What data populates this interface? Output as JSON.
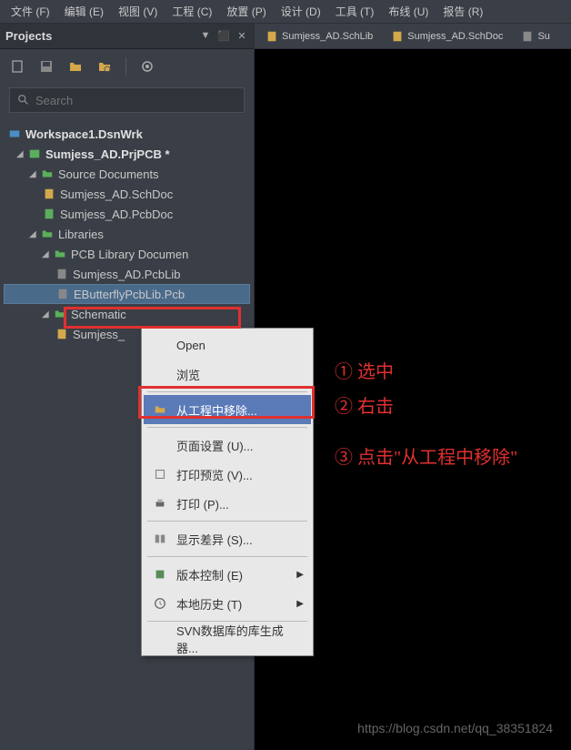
{
  "menubar": {
    "items": [
      "文件 (F)",
      "编辑 (E)",
      "视图 (V)",
      "工程 (C)",
      "放置 (P)",
      "设计 (D)",
      "工具 (T)",
      "布线 (U)",
      "报告 (R)"
    ]
  },
  "panel": {
    "title": "Projects"
  },
  "tabs": [
    "Sumjess_AD.SchLib",
    "Sumjess_AD.SchDoc",
    "Su"
  ],
  "search": {
    "placeholder": "Search"
  },
  "tree": {
    "workspace": "Workspace1.DsnWrk",
    "project": "Sumjess_AD.PrjPCB *",
    "source_docs": "Source Documents",
    "schdoc": "Sumjess_AD.SchDoc",
    "pcbdoc": "Sumjess_AD.PcbDoc",
    "libraries": "Libraries",
    "pcblib_folder": "PCB Library Documen",
    "pcblib": "Sumjess_AD.PcbLib",
    "butterfly": "EButterflyPcbLib.Pcb",
    "schematic": "Schematic",
    "sumjess_partial": "Sumjess_"
  },
  "context_menu": {
    "open": "Open",
    "browse": "浏览",
    "remove": "从工程中移除...",
    "page_setup": "页面设置 (U)...",
    "print_preview": "打印预览 (V)...",
    "print": "打印 (P)...",
    "show_diff": "显示差异 (S)...",
    "version_ctrl": "版本控制 (E)",
    "local_history": "本地历史 (T)",
    "svn_gen": "SVN数据库的库生成器..."
  },
  "annotations": {
    "step1": "① 选中",
    "step2": "② 右击",
    "step3": "③ 点击\"从工程中移除\""
  },
  "watermark": "https://blog.csdn.net/qq_38351824"
}
